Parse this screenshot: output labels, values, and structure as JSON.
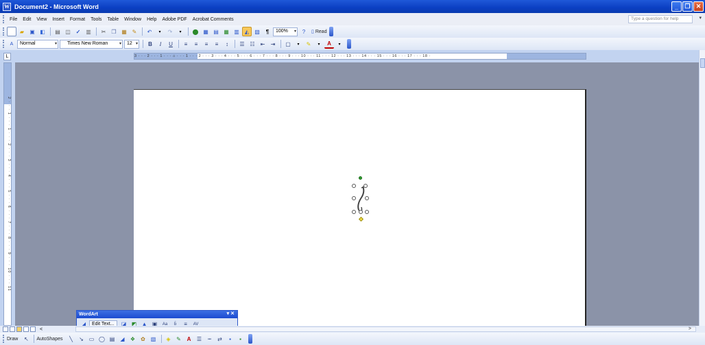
{
  "window": {
    "title": "Document2 - Microsoft Word"
  },
  "menubar": {
    "items": [
      "File",
      "Edit",
      "View",
      "Insert",
      "Format",
      "Tools",
      "Table",
      "Window",
      "Help",
      "Adobe PDF",
      "Acrobat Comments"
    ],
    "help_placeholder": "Type a question for help"
  },
  "standard_toolbar": {
    "zoom": "100%",
    "read_label": "Read"
  },
  "formatting_toolbar": {
    "style": "Normal",
    "font": "Times New Roman",
    "size": "12",
    "bold": "B",
    "italic": "I",
    "underline": "U",
    "font_color_letter": "A"
  },
  "horizontal_ruler": {
    "ticks": "3 · · · 2 · · · 1 · · · ⌂ · · · 1 · · · 2 · · · 3 · · · 4 · · · 5 · · · 6 · · · 7 · · · 8 · · · 9 · · · 10 · · · 11 · · · 12 · · · 13 · · · 14 · · · 15 · · · 16 · · · 17 · · · 18 ·"
  },
  "vertical_ruler": {
    "ticks": "2 · · · 1 · · · 1 · · · 2 · · · 3 · · · 4 · · · 5 · · · 6 · · · 7 · · · 8 · · · 9 · · · 10 · · · 11"
  },
  "wordart_toolbar": {
    "title": "WordArt",
    "edit_text_label": "Edit Text..."
  },
  "drawing_toolbar": {
    "draw_label": "Draw",
    "autoshapes_label": "AutoShapes"
  }
}
